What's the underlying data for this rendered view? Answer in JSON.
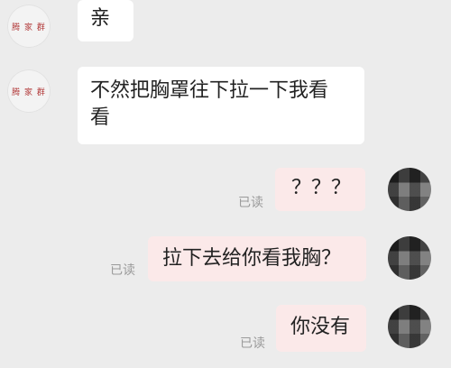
{
  "messages": [
    {
      "id": "m1",
      "side": "left",
      "avatar_text": "腾 家 群",
      "text": "亲"
    },
    {
      "id": "m2",
      "side": "left",
      "avatar_text": "腾 家 群",
      "text_line1": "不然把胸罩往下拉一下我看",
      "text_line2": "看"
    },
    {
      "id": "m3",
      "side": "right",
      "text": "？？？",
      "read": "已读"
    },
    {
      "id": "m4",
      "side": "right",
      "text": "拉下去给你看我胸？",
      "read": "已读"
    },
    {
      "id": "m5",
      "side": "right",
      "text": "你没有",
      "read": "已读"
    }
  ],
  "colors": {
    "background": "#ececec",
    "incoming_bubble": "#ffffff",
    "outgoing_bubble": "#fbe9e9",
    "read_text": "#9a9a9a",
    "avatar_logo": "#b23a3a"
  }
}
